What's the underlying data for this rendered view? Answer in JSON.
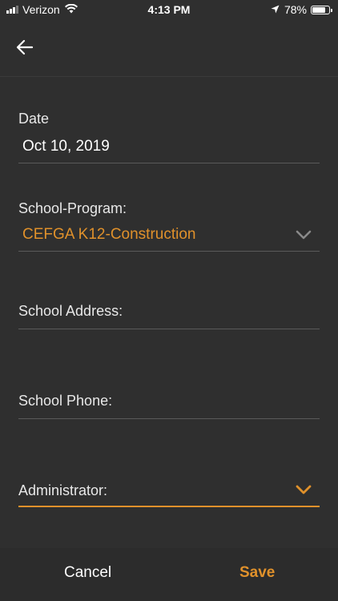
{
  "status_bar": {
    "carrier": "Verizon",
    "time": "4:13 PM",
    "battery_percent": "78%",
    "battery_level": 0.78,
    "signal_bars": 3,
    "icons": [
      "signal-icon",
      "wifi-icon",
      "location-arrow-icon",
      "battery-icon"
    ]
  },
  "nav": {
    "back_icon": "arrow-left-icon"
  },
  "form": {
    "date": {
      "label": "Date",
      "value": "Oct 10, 2019"
    },
    "school_program": {
      "label": "School-Program:",
      "value": "CEFGA K12-Construction",
      "icon": "chevron-down-icon"
    },
    "school_address": {
      "label": "School Address:",
      "value": ""
    },
    "school_phone": {
      "label": "School Phone:",
      "value": ""
    },
    "administrator": {
      "label": "Administrator:",
      "value": "",
      "icon": "chevron-down-icon"
    }
  },
  "footer": {
    "cancel_label": "Cancel",
    "save_label": "Save"
  },
  "colors": {
    "background": "#2f2f2f",
    "accent": "#e0912b",
    "text": "#ffffff",
    "divider": "#5a5a5a"
  }
}
